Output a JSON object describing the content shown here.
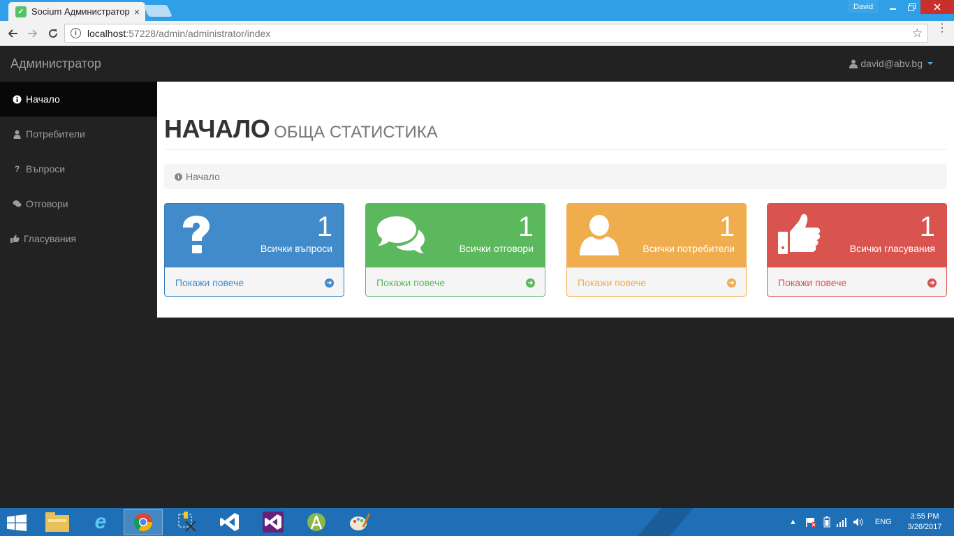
{
  "browser": {
    "tab_title": "Socium Администратор",
    "tab_close": "×",
    "user_chip": "David",
    "url_host": "localhost",
    "url_path": ":57228/admin/administrator/index"
  },
  "app": {
    "brand": "Администратор",
    "user_email": "david@abv.bg"
  },
  "sidebar": {
    "items": [
      {
        "label": "Начало",
        "icon": "info-circle-icon",
        "active": true
      },
      {
        "label": "Потребители",
        "icon": "user-icon",
        "active": false
      },
      {
        "label": "Въпроси",
        "icon": "question-icon",
        "active": false
      },
      {
        "label": "Отговори",
        "icon": "comments-icon",
        "active": false
      },
      {
        "label": "Гласувания",
        "icon": "thumbs-up-icon",
        "active": false
      }
    ]
  },
  "page": {
    "title": "НАЧАЛО",
    "subtitle": "ОБЩА СТАТИСТИКА",
    "breadcrumb": "Начало"
  },
  "panels": [
    {
      "count": "1",
      "label": "Всички въпроси",
      "link": "Покажи повече",
      "icon": "question-icon",
      "color": "#428bca"
    },
    {
      "count": "1",
      "label": "Всички отговори",
      "link": "Покажи повече",
      "icon": "comments-icon",
      "color": "#5cb85c"
    },
    {
      "count": "1",
      "label": "Всички потребители",
      "link": "Покажи повече",
      "icon": "user-icon",
      "color": "#f0ad4e"
    },
    {
      "count": "1",
      "label": "Всички гласувания",
      "link": "Покажи повече",
      "icon": "thumbs-up-icon",
      "color": "#d9534f"
    }
  ],
  "taskbar": {
    "language": "ENG",
    "time": "3:55 PM",
    "date": "3/26/2017"
  }
}
